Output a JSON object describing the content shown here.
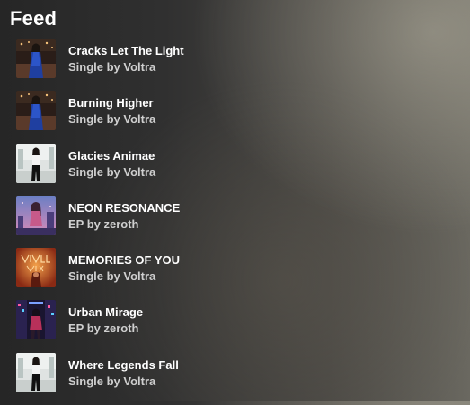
{
  "feed": {
    "title": "Feed",
    "items": [
      {
        "title": "Cracks Let The Light",
        "subtitle": "Single by Voltra",
        "artwork": "woman-blue-dress-art"
      },
      {
        "title": "Burning Higher",
        "subtitle": "Single by Voltra",
        "artwork": "woman-blue-dress-art"
      },
      {
        "title": "Glacies Animae",
        "subtitle": "Single by Voltra",
        "artwork": "woman-standing-art"
      },
      {
        "title": "NEON RESONANCE",
        "subtitle": "EP by zeroth",
        "artwork": "neon-city-art"
      },
      {
        "title": "MEMORIES OF YOU",
        "subtitle": "Single by Voltra",
        "artwork": "memories-art"
      },
      {
        "title": "Urban Mirage",
        "subtitle": "EP by zeroth",
        "artwork": "urban-night-art"
      },
      {
        "title": "Where Legends Fall",
        "subtitle": "Single by Voltra",
        "artwork": "woman-standing-art"
      }
    ]
  }
}
